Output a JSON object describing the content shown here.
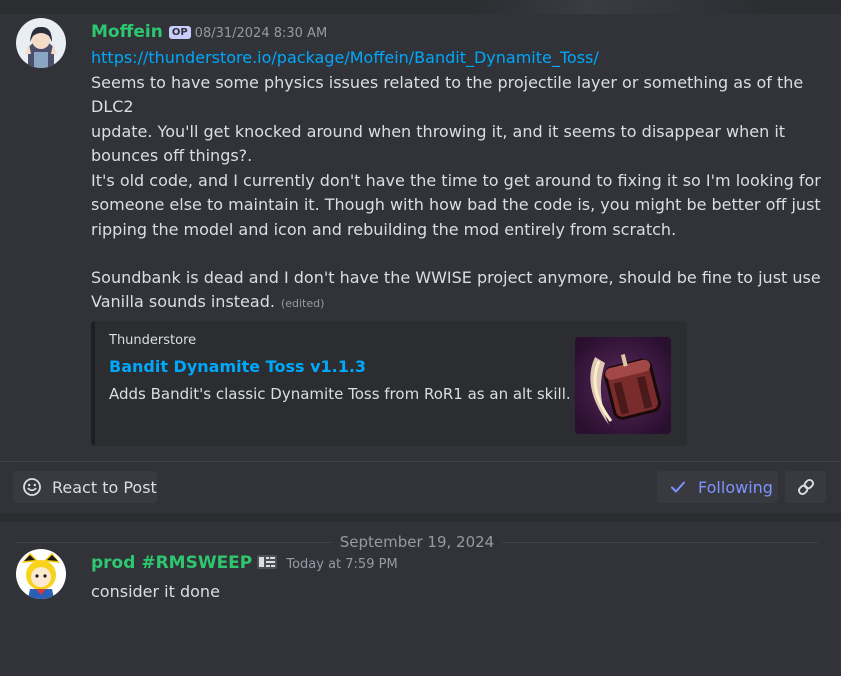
{
  "message1": {
    "author": "Moffein",
    "badge": "OP",
    "timestamp": "08/31/2024 8:30 AM",
    "link": "https://thunderstore.io/package/Moffein/Bandit_Dynamite_Toss/",
    "paragraph1": "Seems to have some physics issues related to the projectile layer or something as of the DLC2\nupdate. You'll get knocked around when throwing it, and it seems to disappear when it\nbounces off things?.",
    "paragraph2": "It's old code, and I currently don't have the time to get around to fixing it so I'm looking for\nsomeone else to maintain it. Though with how bad the code is, you might be better off just\nripping the model and icon and rebuilding the mod entirely from scratch.",
    "paragraph3": "Soundbank is dead and I don't have the WWISE project anymore, should be fine to just use\nVanilla sounds instead.",
    "edited": "(edited)",
    "embed": {
      "provider": "Thunderstore",
      "title": "Bandit Dynamite Toss v1.1.3",
      "description": "Adds Bandit's classic Dynamite Toss from RoR1 as an alt skill."
    }
  },
  "actions": {
    "react_label": "React to Post",
    "following_label": "Following"
  },
  "date_separator": "September 19, 2024",
  "message2": {
    "author": "prod #RMSWEEP",
    "timestamp": "Today at 7:59 PM",
    "text": "consider it done"
  },
  "colors": {
    "background": "#313338",
    "username": "#2dc770",
    "link": "#00a8fc",
    "following": "#7d93ff"
  }
}
